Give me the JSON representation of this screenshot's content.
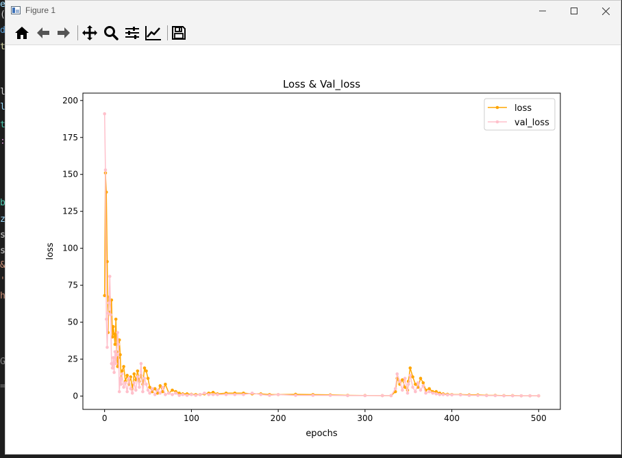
{
  "window": {
    "title": "Figure 1"
  },
  "toolbar": {
    "buttons": [
      {
        "name": "home",
        "icon": "home-icon"
      },
      {
        "name": "back",
        "icon": "arrow-left-icon"
      },
      {
        "name": "forward",
        "icon": "arrow-right-icon"
      },
      {
        "name": "pan",
        "icon": "move-icon"
      },
      {
        "name": "zoom",
        "icon": "magnifier-icon"
      },
      {
        "name": "configure-subplots",
        "icon": "sliders-icon"
      },
      {
        "name": "edit-axis",
        "icon": "line-chart-icon"
      },
      {
        "name": "save",
        "icon": "floppy-disk-icon"
      }
    ]
  },
  "editor_glimpse": [
    "e",
    "(",
    "d",
    "t",
    "l",
    "l",
    "t",
    ":",
    "b",
    "z",
    "s",
    "s",
    "&",
    "'",
    "h",
    "G",
    "="
  ],
  "chart_data": {
    "type": "line",
    "title": "Loss & Val_loss",
    "xlabel": "epochs",
    "ylabel": "loss",
    "xlim": [
      -25,
      525
    ],
    "ylim": [
      -9,
      205
    ],
    "xticks": [
      0,
      100,
      200,
      300,
      400,
      500
    ],
    "yticks": [
      0,
      25,
      50,
      75,
      100,
      125,
      150,
      175,
      200
    ],
    "grid": false,
    "legend": "top-right",
    "colors": {
      "loss": "#FFA500",
      "val_loss": "#FFC0CB"
    },
    "series": [
      {
        "name": "loss",
        "color": "#FFA500",
        "x": [
          0,
          1,
          2,
          3,
          4,
          5,
          6,
          7,
          8,
          9,
          10,
          11,
          12,
          13,
          14,
          15,
          16,
          17,
          18,
          19,
          20,
          22,
          24,
          26,
          28,
          30,
          32,
          34,
          36,
          38,
          40,
          42,
          44,
          46,
          48,
          50,
          52,
          55,
          58,
          61,
          64,
          67,
          70,
          74,
          78,
          82,
          86,
          90,
          95,
          100,
          105,
          110,
          115,
          120,
          125,
          130,
          140,
          150,
          160,
          170,
          180,
          190,
          200,
          220,
          240,
          260,
          280,
          300,
          320,
          330,
          335,
          337,
          340,
          343,
          346,
          349,
          350,
          352,
          355,
          358,
          361,
          364,
          367,
          370,
          374,
          378,
          382,
          386,
          390,
          395,
          400,
          410,
          420,
          430,
          440,
          450,
          460,
          470,
          480,
          490,
          500
        ],
        "values": [
          68,
          151,
          138,
          91,
          43,
          67,
          65,
          57,
          65,
          40,
          47,
          42,
          35,
          52,
          30,
          20,
          26,
          38,
          28,
          12,
          17,
          20,
          10,
          14,
          8,
          13,
          5,
          15,
          11,
          17,
          10,
          14,
          8,
          19,
          17,
          12,
          6,
          3,
          5,
          2,
          7,
          3,
          8,
          2,
          4,
          3,
          2,
          1.5,
          1.5,
          1.2,
          1,
          1,
          1.5,
          2,
          2.5,
          1.5,
          2,
          2,
          2,
          1.5,
          1.5,
          1,
          1,
          1.2,
          1,
          0.8,
          0.5,
          0.4,
          0.3,
          0.3,
          3,
          12,
          8,
          11,
          6,
          4,
          10,
          19,
          13,
          8,
          6,
          12,
          9,
          4,
          5,
          3,
          3,
          2,
          1.5,
          1.2,
          1,
          1,
          0.8,
          0.8,
          0.5,
          0.5,
          0.3,
          0.3,
          0.2,
          0.2,
          0.2
        ]
      },
      {
        "name": "val_loss",
        "color": "#FFC0CB",
        "x": [
          0,
          1,
          2,
          3,
          4,
          5,
          6,
          7,
          8,
          9,
          10,
          11,
          12,
          13,
          14,
          15,
          16,
          17,
          18,
          19,
          20,
          22,
          24,
          26,
          28,
          30,
          32,
          34,
          36,
          38,
          40,
          42,
          44,
          46,
          48,
          50,
          52,
          55,
          58,
          61,
          64,
          67,
          70,
          74,
          78,
          82,
          86,
          90,
          95,
          100,
          105,
          110,
          115,
          120,
          125,
          130,
          140,
          150,
          160,
          170,
          180,
          190,
          200,
          220,
          240,
          260,
          280,
          300,
          320,
          330,
          335,
          337,
          340,
          343,
          346,
          349,
          350,
          352,
          355,
          358,
          361,
          364,
          367,
          370,
          374,
          378,
          382,
          386,
          390,
          395,
          400,
          410,
          420,
          430,
          440,
          450,
          460,
          470,
          480,
          490,
          500
        ],
        "values": [
          191,
          153,
          52,
          33,
          56,
          63,
          81,
          55,
          22,
          19,
          26,
          16,
          30,
          22,
          28,
          43,
          35,
          3,
          12,
          8,
          15,
          6,
          9,
          3,
          12,
          5,
          2,
          9,
          4,
          13,
          6,
          22,
          3,
          12,
          8,
          4,
          2,
          5,
          1,
          4,
          2,
          6,
          1,
          2,
          1,
          2,
          0.5,
          1,
          0.5,
          1,
          0.5,
          1,
          2,
          1,
          1,
          1,
          1,
          1,
          1,
          2,
          1,
          0.5,
          1,
          0.5,
          0.5,
          0.5,
          0.3,
          0.3,
          0.3,
          0.3,
          5,
          15,
          10,
          4,
          12,
          2,
          8,
          14,
          6,
          3,
          9,
          4,
          7,
          2,
          3,
          2,
          1.5,
          1,
          1,
          0.8,
          0.8,
          0.8,
          0.5,
          0.5,
          0.3,
          0.3,
          0.2,
          0.2,
          0.2,
          0.2,
          0.2
        ]
      }
    ]
  }
}
